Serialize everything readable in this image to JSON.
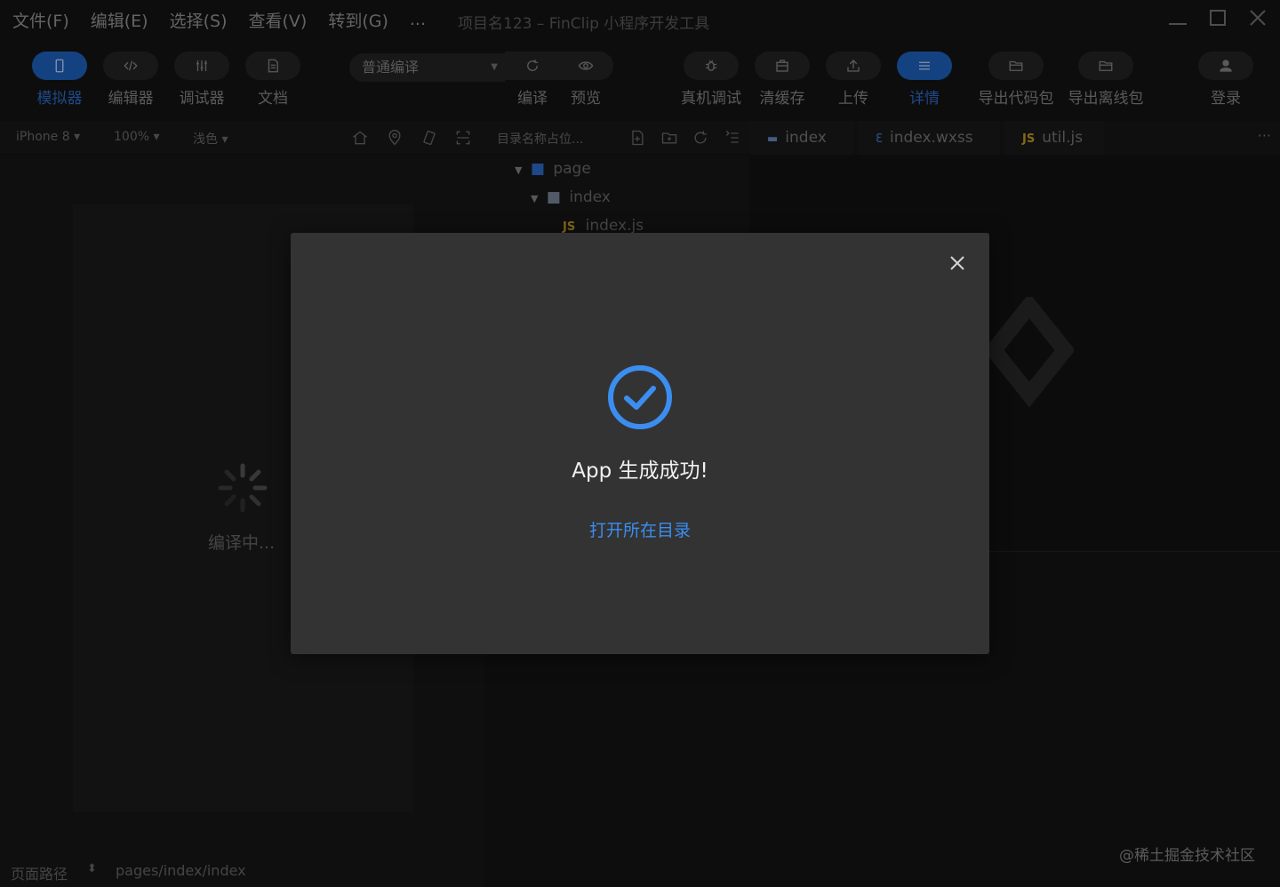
{
  "menubar": {
    "items": [
      "文件(F)",
      "编辑(E)",
      "选择(S)",
      "查看(V)",
      "转到(G)",
      "..."
    ],
    "window_title": "项目名123 – FinClip 小程序开发工具"
  },
  "toolbar": {
    "simulator": "模拟器",
    "editor": "编辑器",
    "debugger": "调试器",
    "docs": "文档",
    "compile_mode": "普通编译",
    "compile": "编译",
    "preview": "预览",
    "device_debug": "真机调试",
    "clear_cache": "清缓存",
    "upload": "上传",
    "details": "详情",
    "export_code": "导出代码包",
    "export_offline": "导出离线包",
    "login": "登录"
  },
  "subbar": {
    "device": "iPhone 8",
    "zoom": "100%",
    "theme": "浅色",
    "dir_placeholder": "目录名称占位..."
  },
  "tabs": [
    {
      "icon": "folder-icon",
      "label": "index"
    },
    {
      "icon": "css-file-icon",
      "label": "index.wxss"
    },
    {
      "icon": "js-file-icon",
      "label": "util.js"
    }
  ],
  "more_label": "···",
  "tree": {
    "page": "page",
    "index": "index",
    "index_js": "index.js",
    "js_tag": "JS"
  },
  "simulator": {
    "loading": "编译中..."
  },
  "statusbar": {
    "label": "页面路径",
    "path": "pages/index/index"
  },
  "watermark": "@稀土掘金技术社区",
  "modal": {
    "message": "App 生成成功!",
    "link": "打开所在目录"
  },
  "colors": {
    "accent": "#3b8ef0",
    "active_tool": "#1f66c7"
  }
}
